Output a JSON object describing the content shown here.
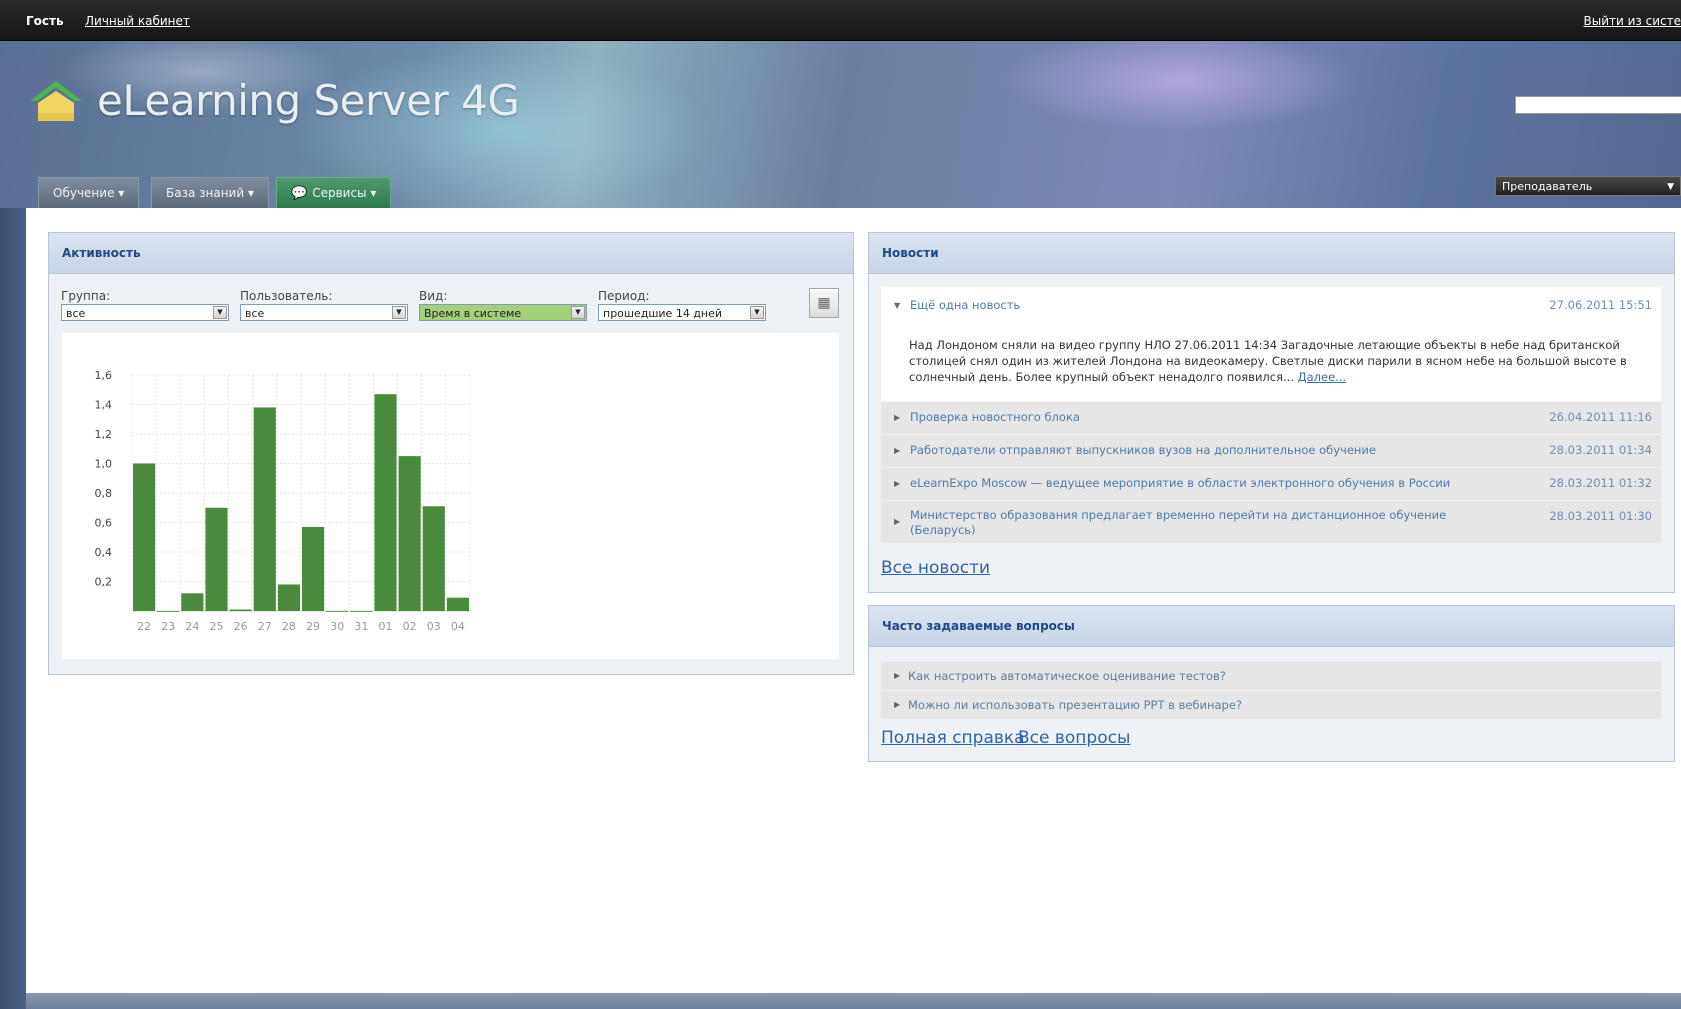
{
  "topbar": {
    "guest": "Гость",
    "cabinet": "Личный кабинет",
    "logout": "Выйти из систе"
  },
  "header": {
    "logo_text": "eLearning Server 4G",
    "role": "Преподаватель"
  },
  "nav": {
    "tabs": [
      {
        "label": "Обучение ▾"
      },
      {
        "label": "База знаний ▾"
      },
      {
        "label": "Сервисы ▾"
      }
    ]
  },
  "activity": {
    "title": "Активность",
    "filters": {
      "group": {
        "label": "Группа:",
        "value": "все"
      },
      "user": {
        "label": "Пользователь:",
        "value": "все"
      },
      "view": {
        "label": "Вид:",
        "value": "Время в системе"
      },
      "period": {
        "label": "Период:",
        "value": "прошедшие 14 дней"
      }
    }
  },
  "chart_data": {
    "type": "bar",
    "categories": [
      "22",
      "23",
      "24",
      "25",
      "26",
      "27",
      "28",
      "29",
      "30",
      "31",
      "01",
      "02",
      "03",
      "04"
    ],
    "values": [
      1.0,
      0,
      0.12,
      0.7,
      0.01,
      1.38,
      0.18,
      0.57,
      0,
      0,
      1.47,
      1.05,
      0.71,
      0.09
    ],
    "yticks": [
      "0,2",
      "0,4",
      "0,6",
      "0,8",
      "1,0",
      "1,2",
      "1,4",
      "1,6"
    ],
    "ylim": [
      0,
      1.6
    ],
    "color": "#4a8a3c",
    "grid": true
  },
  "news": {
    "title": "Новости",
    "items": [
      {
        "title": "Ещё одна новость",
        "date": "27.06.2011 15:51",
        "body": "Над Лондоном сняли на видео группу НЛО 27.06.2011 14:34 Загадочные летающие объекты в небе над британской столицей снял один из жителей Лондона на видеокамеру. Светлые диски парили в ясном небе на большой высоте в солнечный день. Более крупный объект ненадолго появился...",
        "more": "Далее..."
      },
      {
        "title": "Проверка новостного блока",
        "date": "26.04.2011 11:16"
      },
      {
        "title": "Работодатели отправляют выпускников вузов на дополнительное обучение",
        "date": "28.03.2011 01:34"
      },
      {
        "title": "eLearnExpo Moscow — ведущее мероприятие в области электронного обучения в России",
        "date": "28.03.2011 01:32"
      },
      {
        "title": "Министерство образования предлагает временно перейти на дистанционное обучение (Беларусь)",
        "date": "28.03.2011 01:30"
      }
    ],
    "all_link": "Все новости"
  },
  "faq": {
    "title": "Часто задаваемые вопросы",
    "items": [
      {
        "question": "Как настроить автоматическое оценивание тестов?"
      },
      {
        "question": "Можно ли использовать презентацию PPT в вебинаре?"
      }
    ],
    "help_link": "Полная справка",
    "all_link": "Все вопросы"
  }
}
